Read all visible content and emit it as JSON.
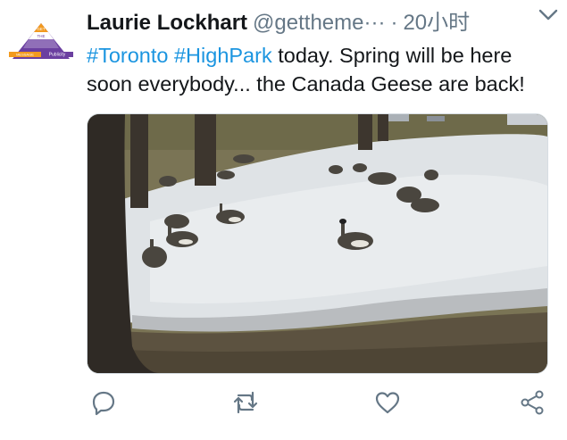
{
  "author": {
    "name": "Laurie Lockhart",
    "handle": "@gettheme···",
    "separator": "·",
    "time": "20小时",
    "avatar_logo": {
      "line1": "GET",
      "line2": "THE",
      "line3": "MESSAGE",
      "line4": "Publicity"
    }
  },
  "tweet": {
    "hashtag_1": "#Toronto",
    "hashtag_2": "#HighPark",
    "text_rest": " today. Spring will be here soon everybody... the Canada Geese are back!"
  },
  "media": {
    "description_icon": "photo"
  },
  "actions": {
    "reply_icon": "reply-icon",
    "retweet_icon": "retweet-icon",
    "like_icon": "like-icon",
    "share_icon": "share-icon"
  },
  "colors": {
    "accent": "#1b95e0",
    "muted": "#657786",
    "text": "#14171a",
    "logo_purple": "#6b3fa0",
    "logo_orange": "#f29a1f"
  }
}
